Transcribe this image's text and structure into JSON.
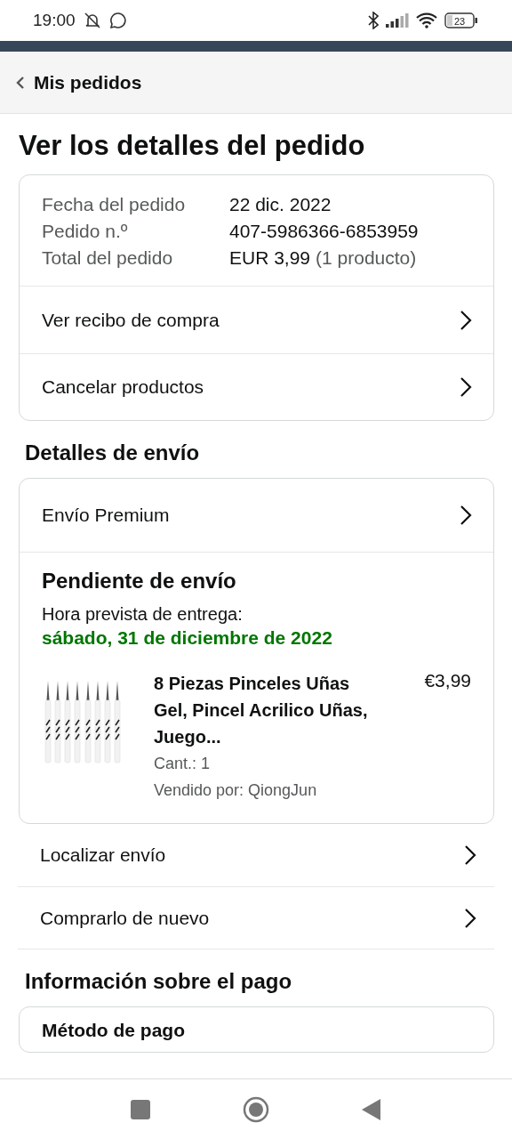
{
  "status_bar": {
    "time": "19:00",
    "battery": "23"
  },
  "header": {
    "back_label": "Mis pedidos"
  },
  "title": "Ver los detalles del pedido",
  "summary": {
    "rows": [
      {
        "label": "Fecha del pedido",
        "value": "22 dic. 2022"
      },
      {
        "label": "Pedido n.º",
        "value": "407-5986366-6853959"
      },
      {
        "label": "Total del pedido",
        "value": "EUR 3,99",
        "note": "(1 producto)"
      }
    ],
    "links": [
      "Ver recibo de compra",
      "Cancelar productos"
    ]
  },
  "shipping": {
    "heading": "Detalles de envío",
    "method": "Envío Premium",
    "status": "Pendiente de envío",
    "eta_label": "Hora prevista de entrega:",
    "eta": "sábado, 31 de diciembre de 2022",
    "item": {
      "title": "8 Piezas Pinceles Uñas Gel, Pincel Acrilico Uñas, Juego...",
      "price": "€3,99",
      "quantity": "Cant.: 1",
      "seller": "Vendido por: QiongJun"
    },
    "links": [
      "Localizar envío",
      "Comprarlo de nuevo"
    ]
  },
  "payment": {
    "heading": "Información sobre el pago",
    "rows": [
      "Método de pago"
    ]
  }
}
